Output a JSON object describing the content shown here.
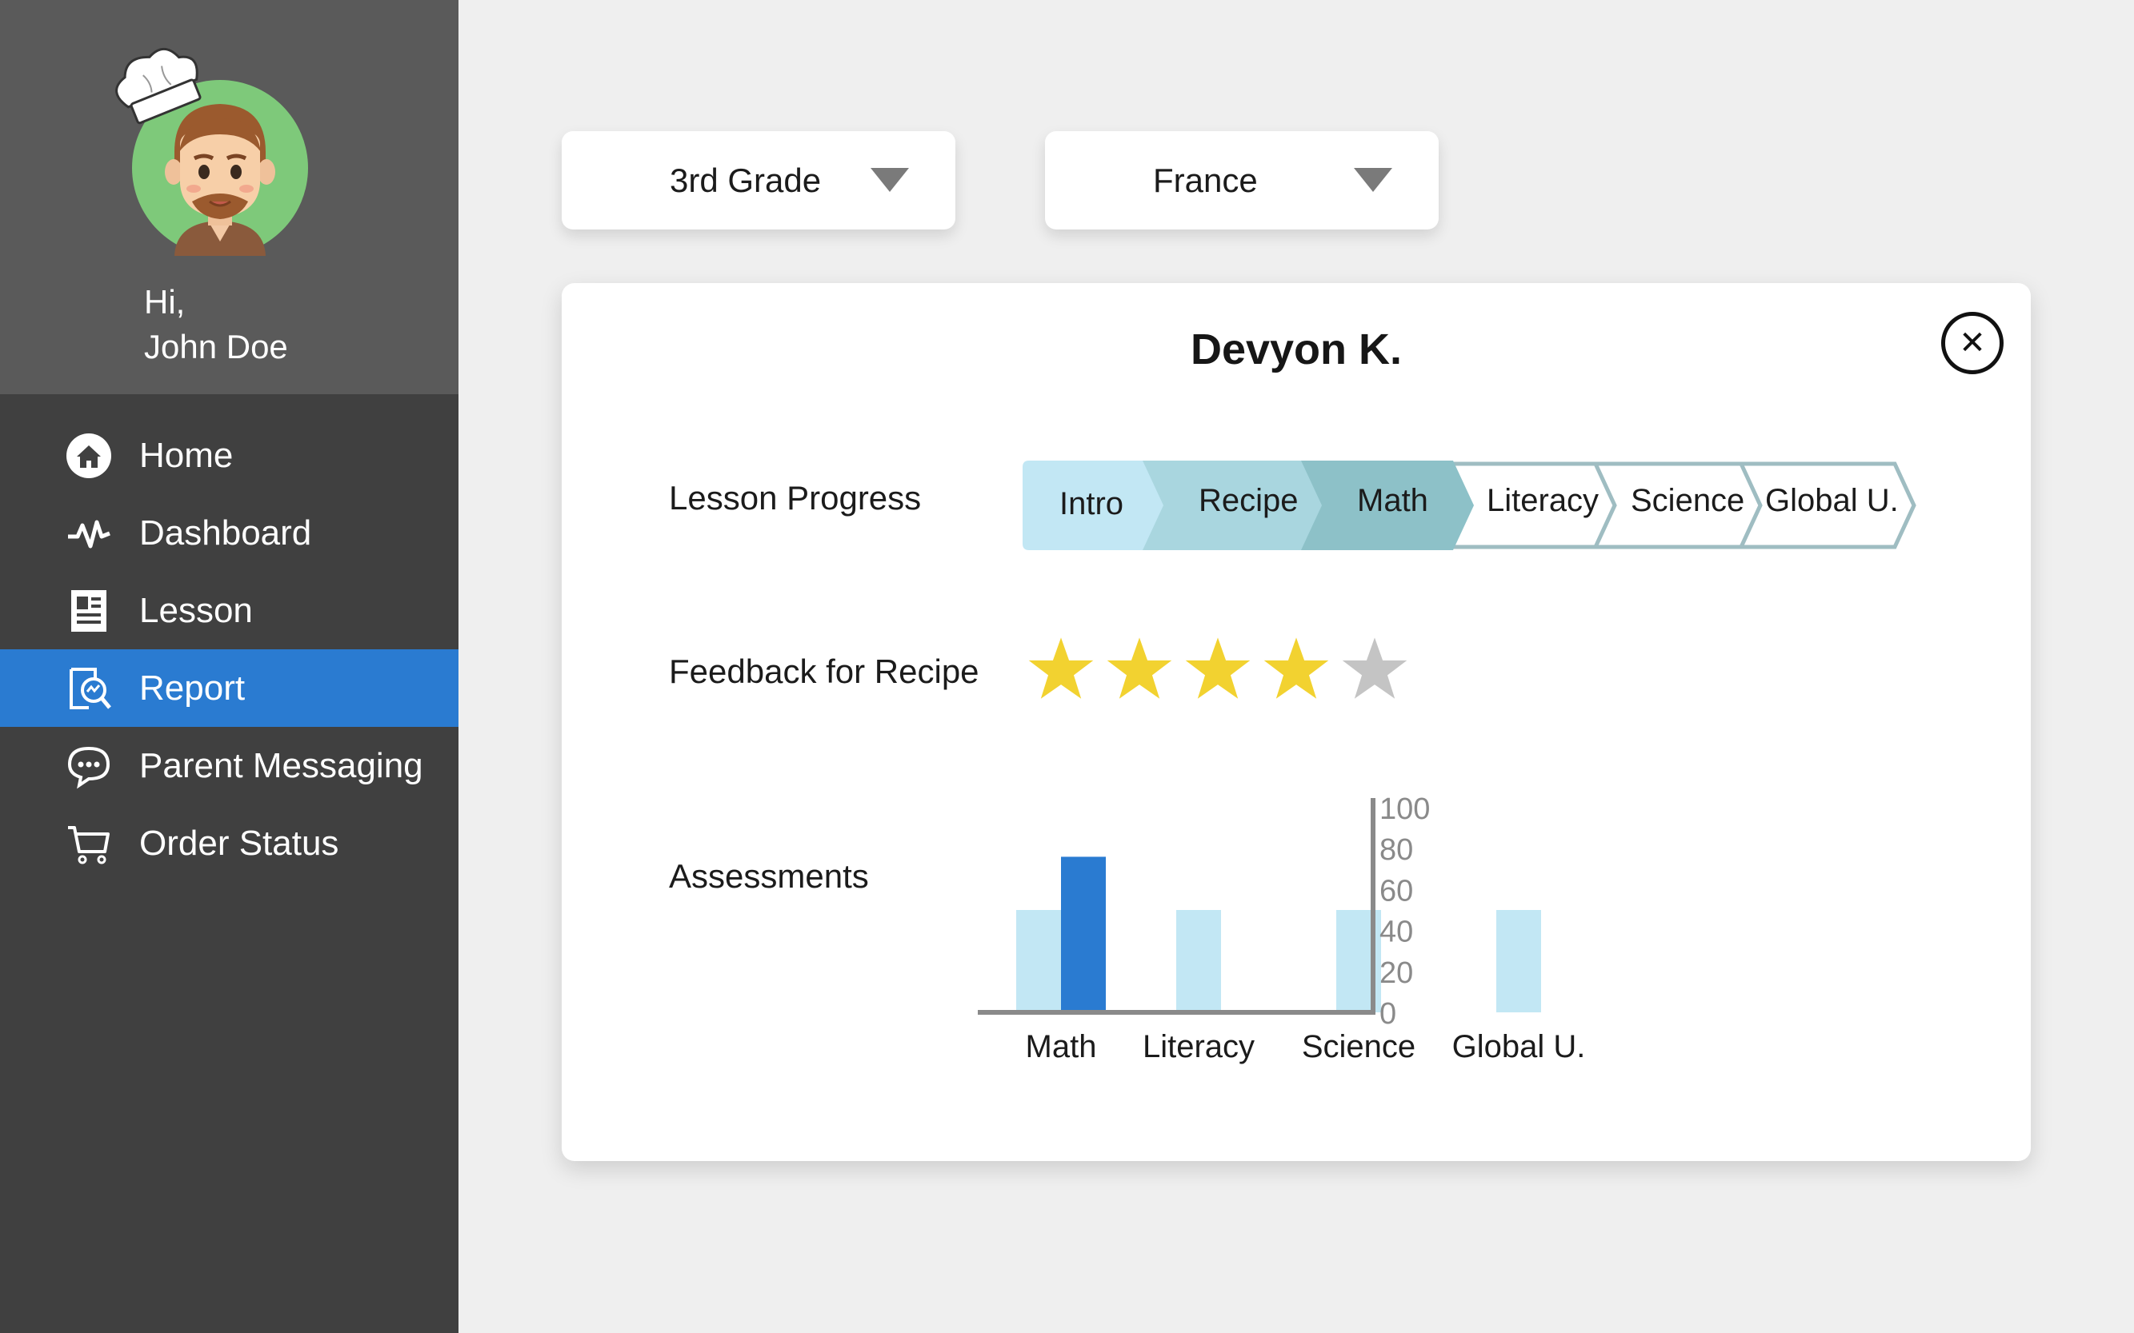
{
  "sidebar": {
    "greeting": "Hi,",
    "user_name": "John Doe",
    "items": [
      {
        "label": "Home",
        "icon": "home-icon"
      },
      {
        "label": "Dashboard",
        "icon": "pulse-icon"
      },
      {
        "label": "Lesson",
        "icon": "document-icon"
      },
      {
        "label": "Report",
        "icon": "report-search-icon",
        "active": true
      },
      {
        "label": "Parent Messaging",
        "icon": "chat-bubble-icon"
      },
      {
        "label": "Order Status",
        "icon": "cart-icon"
      }
    ]
  },
  "filters": {
    "grade": "3rd Grade",
    "country": "France"
  },
  "card": {
    "student_name": "Devyon K.",
    "close_symbol": "✕",
    "lesson_progress_label": "Lesson Progress",
    "steps": [
      {
        "label": "Intro",
        "state": "done",
        "color": "#c2e7f4"
      },
      {
        "label": "Recipe",
        "state": "done",
        "color": "#a9d6df"
      },
      {
        "label": "Math",
        "state": "done",
        "color": "#8dc1c8"
      },
      {
        "label": "Literacy",
        "state": "pending"
      },
      {
        "label": "Science",
        "state": "pending"
      },
      {
        "label": "Global U.",
        "state": "pending"
      }
    ],
    "feedback_label": "Feedback for Recipe",
    "rating": 4,
    "rating_max": 5,
    "assessments_label": "Assessments"
  },
  "chart_data": {
    "type": "bar",
    "categories": [
      "Math",
      "Literacy",
      "Science",
      "Global U."
    ],
    "series": [
      {
        "values": [
          50,
          50,
          50,
          50
        ],
        "color": "#c2e7f4"
      },
      {
        "values": [
          76,
          null,
          null,
          null
        ],
        "color": "#2a7bd1"
      }
    ],
    "ylim": [
      0,
      100
    ],
    "yticks": [
      "100",
      "80",
      "60",
      "40",
      "20",
      "0"
    ],
    "axis_side": "right",
    "grid": false
  },
  "colors": {
    "accent": "#2a7bd1",
    "star_on": "#f2d230",
    "star_off": "#c4c4c4"
  }
}
